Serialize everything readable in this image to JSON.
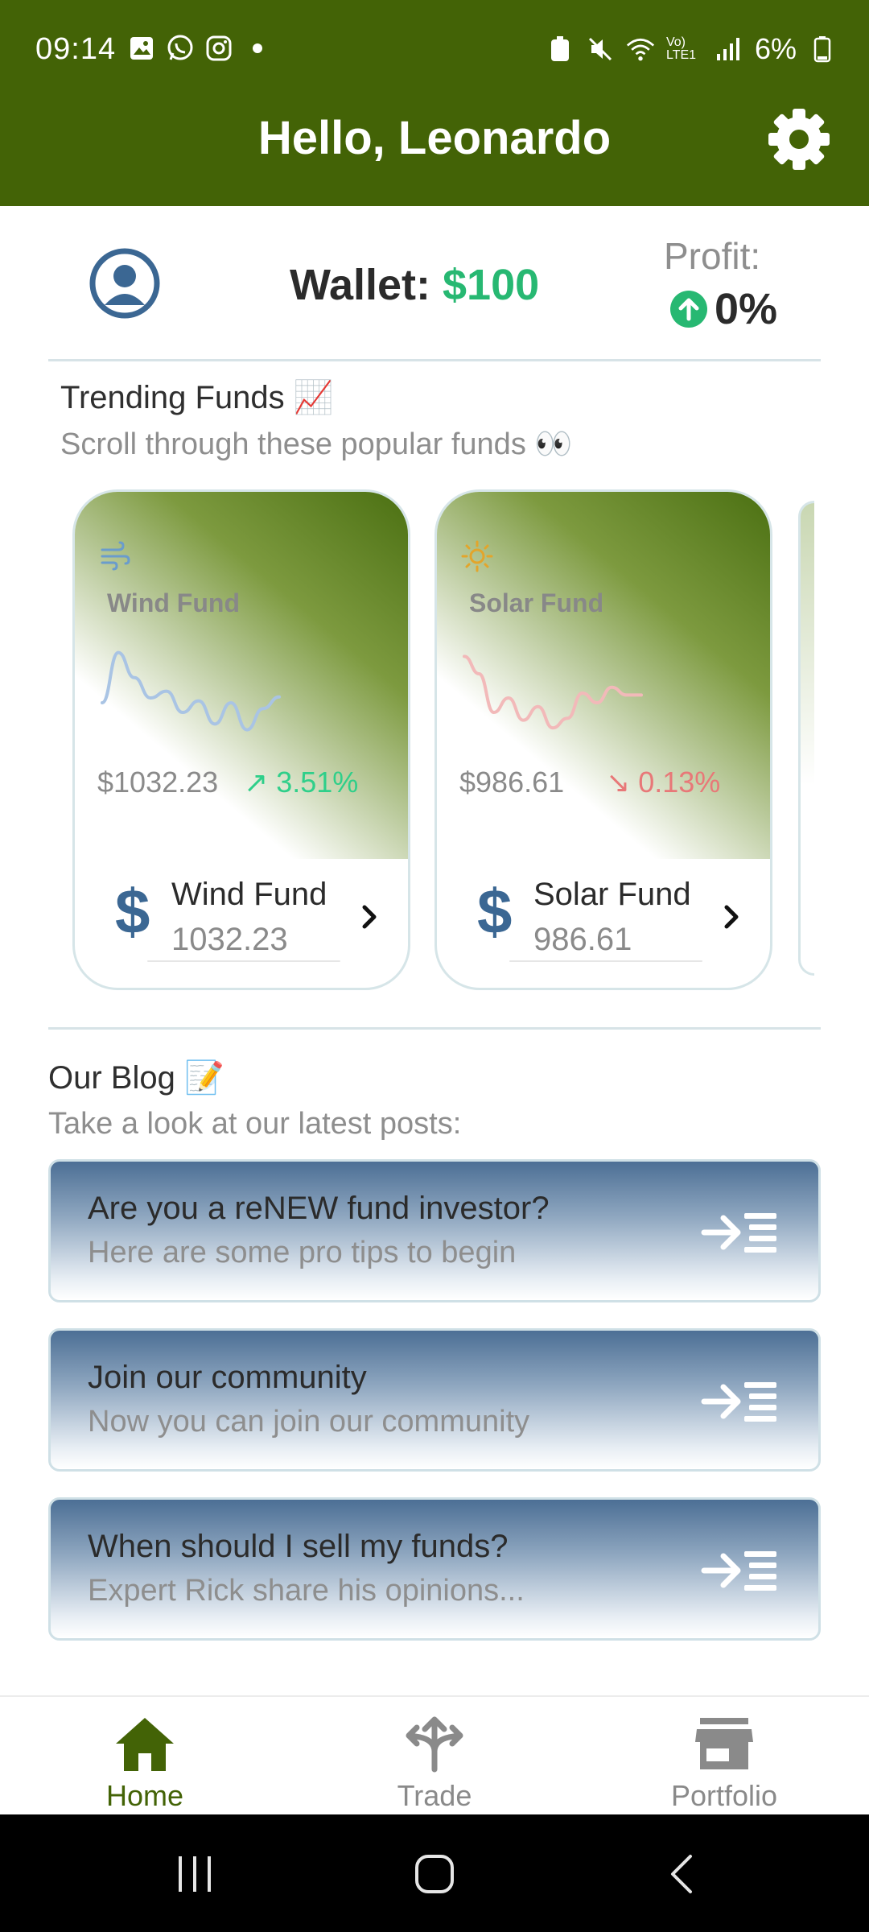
{
  "status_bar": {
    "time": "09:14",
    "battery": "6%",
    "network_label": "Vo) LTE1"
  },
  "header": {
    "title": "Hello, Leonardo",
    "background": "#436306"
  },
  "wallet": {
    "label": "Wallet: ",
    "amount": "$100",
    "profit_label": "Profit:",
    "profit_value": "0%",
    "amount_color": "#27b872"
  },
  "trending": {
    "title": "Trending Funds 📈",
    "subtitle": "Scroll through these popular funds 👀",
    "funds": [
      {
        "icon": "wind-icon",
        "name": "Wind Fund",
        "price": "$1032.23",
        "change": "3.51%",
        "direction": "up",
        "footer_name": "Wind Fund",
        "footer_value": "1032.23",
        "change_color": "#2fcf8a",
        "sparkline": [
          40,
          92,
          66,
          45,
          52,
          30,
          42,
          18,
          40,
          12,
          34,
          46
        ]
      },
      {
        "icon": "sun-icon",
        "name": "Solar Fund",
        "price": "$986.61",
        "change": "0.13%",
        "direction": "down",
        "footer_name": "Solar Fund",
        "footer_value": "986.61",
        "change_color": "#e87878",
        "sparkline": [
          88,
          70,
          30,
          45,
          22,
          36,
          14,
          24,
          50,
          40,
          56,
          48,
          48
        ]
      }
    ]
  },
  "blog": {
    "title": "Our Blog 📝",
    "subtitle": "Take a look at our latest posts:",
    "posts": [
      {
        "title": "Are you a reNEW fund investor?",
        "subtitle": "Here are some pro tips to begin"
      },
      {
        "title": "Join our community",
        "subtitle": "Now you can join our community"
      },
      {
        "title": "When should I sell my funds?",
        "subtitle": "Expert Rick share his opinions..."
      }
    ]
  },
  "bottom_nav": {
    "items": [
      {
        "label": "Home",
        "icon": "home-icon",
        "active": true
      },
      {
        "label": "Trade",
        "icon": "trade-icon",
        "active": false
      },
      {
        "label": "Portfolio",
        "icon": "storefront-icon",
        "active": false
      }
    ],
    "active_color": "#436306",
    "inactive_color": "#8a8a8a"
  }
}
